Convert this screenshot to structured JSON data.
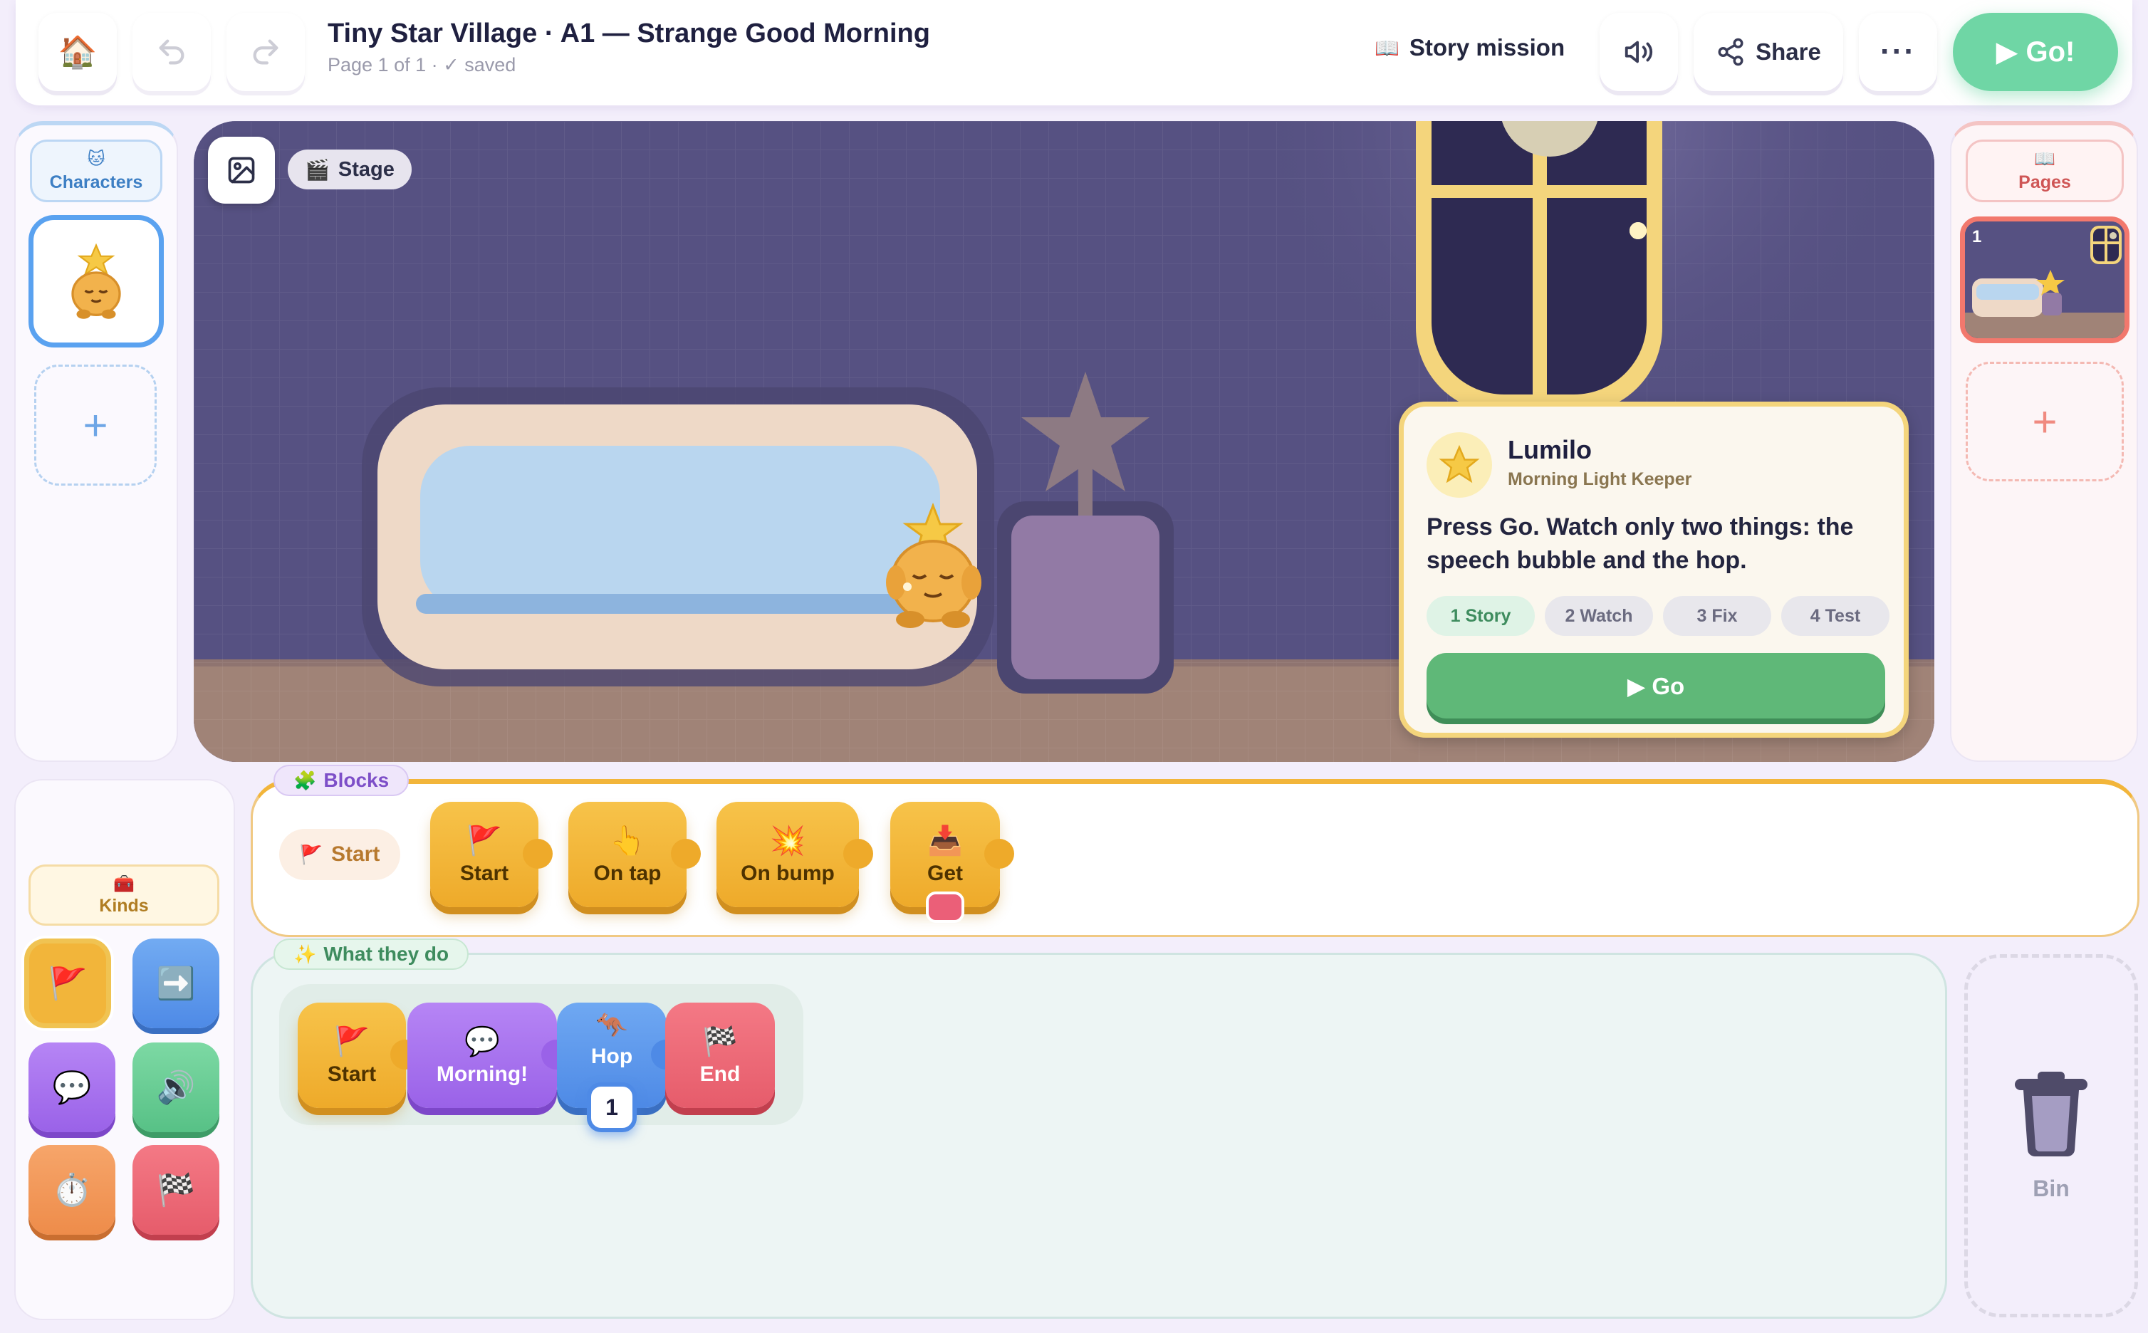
{
  "header": {
    "title": "Tiny Star Village · A1 — Strange Good Morning",
    "subtitle": "Page 1 of 1 · ✓ saved",
    "mission_label": "Story mission",
    "share_label": "Share",
    "go_label": "▶ Go!"
  },
  "characters": {
    "label": "Characters",
    "add_label": "+"
  },
  "pages": {
    "label": "Pages",
    "page_number": "1",
    "add_label": "+"
  },
  "stage": {
    "label": "Stage"
  },
  "mission_card": {
    "name": "Lumilo",
    "role": "Morning Light Keeper",
    "message": "Press Go. Watch only two things: the speech bubble and the hop.",
    "steps": [
      {
        "num": "1",
        "label": "Story"
      },
      {
        "num": "2",
        "label": "Watch"
      },
      {
        "num": "3",
        "label": "Fix"
      },
      {
        "num": "4",
        "label": "Test"
      }
    ],
    "go_label": "▶ Go"
  },
  "blocks": {
    "label": "Blocks",
    "category_label": "Start",
    "items": [
      "Start",
      "On tap",
      "On bump",
      "Get"
    ]
  },
  "kinds": {
    "label": "Kinds"
  },
  "program": {
    "label": "What they do",
    "blocks": [
      "Start",
      "Morning!",
      "Hop",
      "End"
    ],
    "hop_value": "1"
  },
  "bin": {
    "label": "Bin"
  },
  "colors": {
    "go_green": "#6fd6a5",
    "event_yellow": "#f2b53a",
    "looks_purple": "#a672ee",
    "motion_blue": "#5a96ec",
    "end_red": "#eb6675",
    "card_border": "#f4d57c"
  }
}
